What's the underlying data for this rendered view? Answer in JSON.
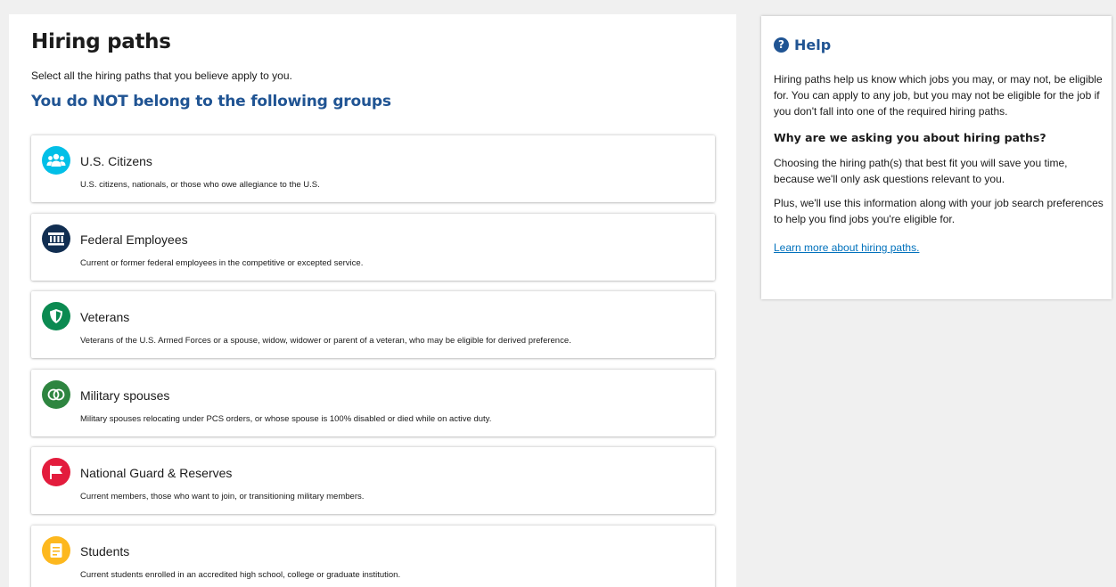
{
  "main": {
    "title": "Hiring paths",
    "intro": "Select all the hiring paths that you believe apply to you.",
    "subheading": "You do NOT belong to the following groups",
    "paths": [
      {
        "title": "U.S. Citizens",
        "description": "U.S. citizens, nationals, or those who owe allegiance to the U.S.",
        "icon": "people-group-icon",
        "color": "#02bfe7"
      },
      {
        "title": "Federal Employees",
        "description": "Current or former federal employees in the competitive or excepted service.",
        "icon": "government-building-icon",
        "color": "#112e51"
      },
      {
        "title": "Veterans",
        "description": "Veterans of the U.S. Armed Forces or a spouse, widow, widower or parent of a veteran, who may be eligible for derived preference.",
        "icon": "shield-icon",
        "color": "#0b8a51"
      },
      {
        "title": "Military spouses",
        "description": "Military spouses relocating under PCS orders, or whose spouse is 100% disabled or died while on active duty.",
        "icon": "interlocking-rings-icon",
        "color": "#2e8540"
      },
      {
        "title": "National Guard & Reserves",
        "description": "Current members, those who want to join, or transitioning military members.",
        "icon": "flag-icon",
        "color": "#e31c3d"
      },
      {
        "title": "Students",
        "description": "Current students enrolled in an accredited high school, college or graduate institution.",
        "icon": "book-icon",
        "color": "#fdb81e"
      }
    ]
  },
  "help": {
    "title": "Help",
    "paragraph1": "Hiring paths help us know which jobs you may, or may not, be eligible for. You can apply to any job, but you may not be eligible for the job if you don't fall into one of the required hiring paths.",
    "question": "Why are we asking you about hiring paths?",
    "paragraph2": "Choosing the hiring path(s) that best fit you will save you time, because we'll only ask questions relevant to you.",
    "paragraph3": "Plus, we'll use this information along with your job search preferences to help you find jobs you're eligible for.",
    "link": "Learn more about hiring paths."
  }
}
